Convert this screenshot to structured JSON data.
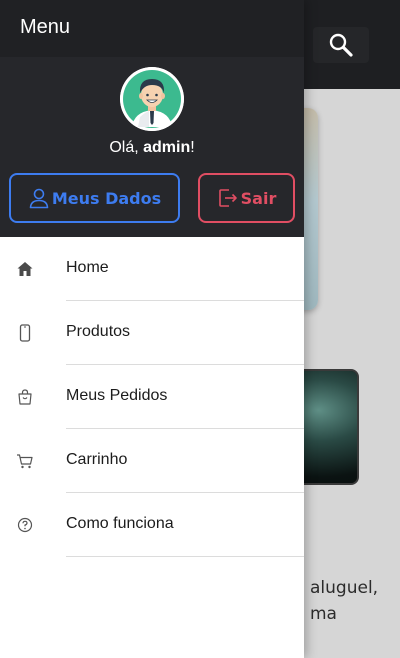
{
  "drawer": {
    "title": "Menu",
    "greeting_prefix": "Olá, ",
    "username": "admin",
    "greeting_suffix": "!",
    "buttons": {
      "profile_label": "Meus Dados",
      "logout_label": "Sair"
    },
    "nav": [
      {
        "label": "Home",
        "icon": "home-icon"
      },
      {
        "label": "Produtos",
        "icon": "smartphone-icon"
      },
      {
        "label": "Meus Pedidos",
        "icon": "shopping-bag-icon"
      },
      {
        "label": "Carrinho",
        "icon": "cart-icon"
      },
      {
        "label": "Como funciona",
        "icon": "help-circle-icon"
      }
    ]
  },
  "background": {
    "partial_text": "aluguel, ma"
  },
  "colors": {
    "drawer_header": "#26272b",
    "menu_bar": "#202124",
    "profile_button": "#3d7cf0",
    "logout_button": "#e04e63",
    "avatar_ring": "#3cba8f"
  }
}
